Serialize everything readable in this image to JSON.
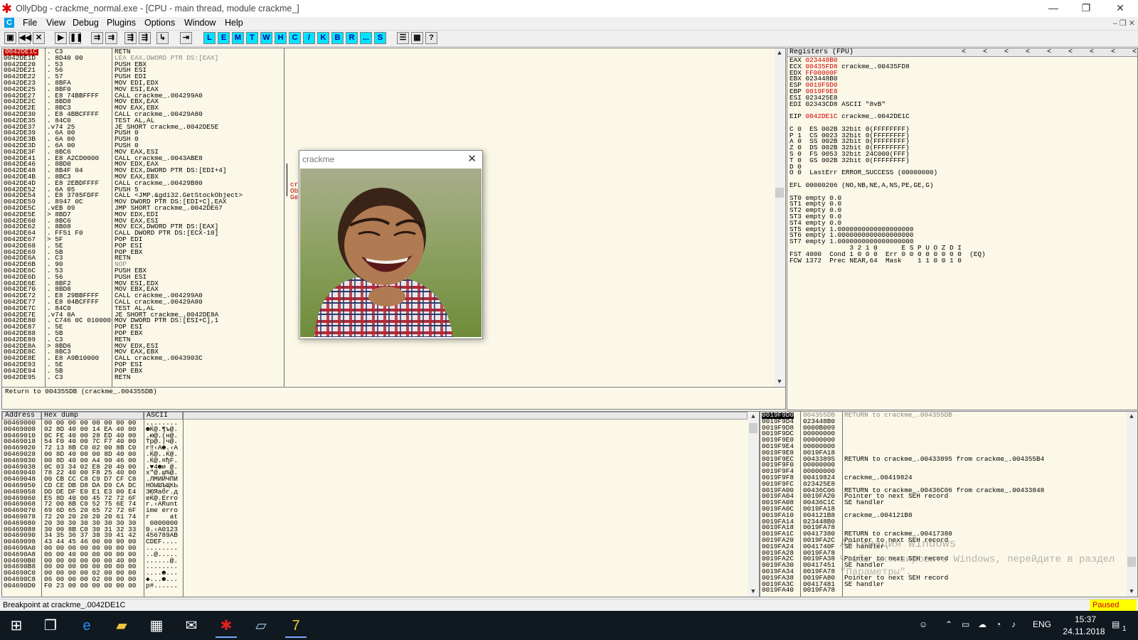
{
  "window": {
    "title": "OllyDbg - crackme_normal.exe - [CPU - main thread, module crackme_]",
    "logo_char": "✱",
    "minimize": "—",
    "restore": "❐",
    "close": "✕"
  },
  "menubar": {
    "icon_char": "C",
    "items": [
      "File",
      "View",
      "Debug",
      "Plugins",
      "Options",
      "Window",
      "Help"
    ],
    "mdi": "–  ❐  ✕"
  },
  "toolbar": {
    "nav_buttons": [
      "▣",
      "◀◀",
      "✕",
      "▶",
      "❚❚",
      "⇉",
      "⇉",
      "⇶",
      "⇶",
      "↳",
      "⇥"
    ],
    "letter_buttons": [
      "L",
      "E",
      "M",
      "T",
      "W",
      "H",
      "C",
      "/",
      "K",
      "B",
      "R",
      "...",
      "S"
    ],
    "extra_buttons": [
      "☰",
      "▦",
      "?"
    ]
  },
  "disasm": {
    "rows": [
      [
        "0042DE1C",
        ". C3",
        "RETN"
      ],
      [
        "0042DE1D",
        ". 8D40 00",
        "LEA EAX,DWORD PTR DS:[EAX]"
      ],
      [
        "0042DE20",
        ". 53",
        "PUSH EBX"
      ],
      [
        "0042DE21",
        ". 56",
        "PUSH ESI"
      ],
      [
        "0042DE22",
        ". 57",
        "PUSH EDI"
      ],
      [
        "0042DE23",
        ". 8BFA",
        "MOV EDI,EDX"
      ],
      [
        "0042DE25",
        ". 8BF0",
        "MOV ESI,EAX"
      ],
      [
        "0042DE27",
        ". E8 74BBFFFF",
        "CALL crackme_.004299A0"
      ],
      [
        "0042DE2C",
        ". 8BD8",
        "MOV EBX,EAX"
      ],
      [
        "0042DE2E",
        ". 8BC3",
        "MOV EAX,EBX"
      ],
      [
        "0042DE30",
        ". E8 4BBCFFFF",
        "CALL crackme_.00429A80"
      ],
      [
        "0042DE35",
        ". 84C0",
        "TEST AL,AL"
      ],
      [
        "0042DE37",
        ".v74 25",
        "JE SHORT crackme_.0042DE5E"
      ],
      [
        "0042DE39",
        ". 6A 00",
        "PUSH 0"
      ],
      [
        "0042DE3B",
        ". 6A 00",
        "PUSH 0"
      ],
      [
        "0042DE3D",
        ". 6A 00",
        "PUSH 0"
      ],
      [
        "0042DE3F",
        ". 8BC6",
        "MOV EAX,ESI"
      ],
      [
        "0042DE41",
        ". E8 A2CD0000",
        "CALL crackme_.0043ABE8"
      ],
      [
        "0042DE46",
        ". 8BD0",
        "MOV EDX,EAX"
      ],
      [
        "0042DE48",
        ". 8B4F 04",
        "MOV ECX,DWORD PTR DS:[EDI+4]"
      ],
      [
        "0042DE4B",
        ". 8BC3",
        "MOV EAX,EBX"
      ],
      [
        "0042DE4D",
        ". E8 2EBDFFFF",
        "CALL crackme_.00429B80"
      ],
      [
        "0042DE52",
        ". 6A 05",
        "PUSH 5"
      ],
      [
        "0042DE54",
        ". E8 3785FDFF",
        "CALL <JMP.&gdi32.GetStockObject>"
      ],
      [
        "0042DE59",
        ". 8947 0C",
        "MOV DWORD PTR DS:[EDI+C],EAX"
      ],
      [
        "0042DE5C",
        ".vEB 09",
        "JMP SHORT crackme_.0042DE67"
      ],
      [
        "0042DE5E",
        "> 8BD7",
        "MOV EDX,EDI"
      ],
      [
        "0042DE60",
        ". 8BC6",
        "MOV EAX,ESI"
      ],
      [
        "0042DE62",
        ". 8B08",
        "MOV ECX,DWORD PTR DS:[EAX]"
      ],
      [
        "0042DE64",
        ". FF51 F0",
        "CALL DWORD PTR DS:[ECX-10]"
      ],
      [
        "0042DE67",
        "> 5F",
        "POP EDI"
      ],
      [
        "0042DE68",
        ". 5E",
        "POP ESI"
      ],
      [
        "0042DE69",
        ". 5B",
        "POP EBX"
      ],
      [
        "0042DE6A",
        ". C3",
        "RETN"
      ],
      [
        "0042DE6B",
        ". 90",
        "NOP"
      ],
      [
        "0042DE6C",
        ". 53",
        "PUSH EBX"
      ],
      [
        "0042DE6D",
        ". 56",
        "PUSH ESI"
      ],
      [
        "0042DE6E",
        ". 8BF2",
        "MOV ESI,EDX"
      ],
      [
        "0042DE70",
        ". 8BD8",
        "MOV EBX,EAX"
      ],
      [
        "0042DE72",
        ". E8 29BBFFFF",
        "CALL crackme_.004299A0"
      ],
      [
        "0042DE77",
        ". E8 04BCFFFF",
        "CALL crackme_.00429A80"
      ],
      [
        "0042DE7C",
        ". 84C0",
        "TEST AL,AL"
      ],
      [
        "0042DE7E",
        ".v74 0A",
        "JE SHORT crackme_.0042DE8A"
      ],
      [
        "0042DE80",
        ". C746 0C 010000",
        "MOV DWORD PTR DS:[ESI+C],1"
      ],
      [
        "0042DE87",
        ". 5E",
        "POP ESI"
      ],
      [
        "0042DE88",
        ". 5B",
        "POP EBX"
      ],
      [
        "0042DE89",
        ". C3",
        "RETN"
      ],
      [
        "0042DE8A",
        "> 8BD6",
        "MOV EDX,ESI"
      ],
      [
        "0042DE8C",
        ". 8BC3",
        "MOV EAX,EBX"
      ],
      [
        "0042DE8E",
        ". E8 A9B10000",
        "CALL crackme_.0043903C"
      ],
      [
        "0042DE93",
        ". 5E",
        "POP ESI"
      ],
      [
        "0042DE94",
        ". 5B",
        "POP EBX"
      ],
      [
        "0042DE95",
        ". C3",
        "RETN"
      ]
    ],
    "comments": [
      "cr",
      "Ob",
      "Ge"
    ]
  },
  "info": {
    "text": "Return to 004355DB (crackme_.004355DB)"
  },
  "registers": {
    "header": "Registers (FPU)",
    "header_arrows": "<    <    <    <    <    <    <    <    <",
    "lines": [
      {
        "text": "EAX 023448B0",
        "red": true
      },
      {
        "text": "ECX 00435FD8 crackme_.00435FD8",
        "red": true
      },
      {
        "text": "EDX FF00000F",
        "red": true
      },
      {
        "text": "EBX 023448B0",
        "red": false
      },
      {
        "text": "ESP 0019F9D0",
        "red": true
      },
      {
        "text": "EBP 0019F9E8",
        "red": true
      },
      {
        "text": "ESI 023425E8",
        "red": false
      },
      {
        "text": "EDI 02343CD8 ASCII \"8vB\"",
        "red": false
      },
      {
        "text": "",
        "red": false
      },
      {
        "text": "EIP 0042DE1C crackme_.0042DE1C",
        "red": true
      },
      {
        "text": "",
        "red": false
      },
      {
        "text": "C 0  ES 002B 32bit 0(FFFFFFFF)",
        "red": false
      },
      {
        "text": "P 1  CS 0023 32bit 0(FFFFFFFF)",
        "red": false
      },
      {
        "text": "A 0  SS 002B 32bit 0(FFFFFFFF)",
        "red": false
      },
      {
        "text": "Z 0  DS 002B 32bit 0(FFFFFFFF)",
        "red": false
      },
      {
        "text": "S 0  FS 0053 32bit 24C000(FFF)",
        "red": false
      },
      {
        "text": "T 0  GS 002B 32bit 0(FFFFFFFF)",
        "red": false
      },
      {
        "text": "D 0",
        "red": false
      },
      {
        "text": "O 0  LastErr ERROR_SUCCESS (00000000)",
        "red": false
      },
      {
        "text": "",
        "red": false
      },
      {
        "text": "EFL 00000206 (NO,NB,NE,A,NS,PE,GE,G)",
        "red": false
      },
      {
        "text": "",
        "red": false
      },
      {
        "text": "ST0 empty 0.0",
        "red": false
      },
      {
        "text": "ST1 empty 0.0",
        "red": false
      },
      {
        "text": "ST2 empty 0.0",
        "red": false
      },
      {
        "text": "ST3 empty 0.0",
        "red": false
      },
      {
        "text": "ST4 empty 0.0",
        "red": false
      },
      {
        "text": "ST5 empty 1.0000000000000000000",
        "red": false
      },
      {
        "text": "ST6 empty 1.0000000000000000000",
        "red": false
      },
      {
        "text": "ST7 empty 1.0000000000000000000",
        "red": false
      },
      {
        "text": "               3 2 1 0      E S P U O Z D I",
        "red": false
      },
      {
        "text": "FST 4000  Cond 1 0 0 0  Err 0 0 0 0 0 0 0 0  (EQ)",
        "red": false
      },
      {
        "text": "FCW 1372  Prec NEAR,64  Mask    1 1 0 0 1 0",
        "red": false
      }
    ]
  },
  "hexdump": {
    "headers": [
      "Address",
      "Hex dump",
      "ASCII"
    ],
    "rows": [
      [
        "00469000",
        "00 00 00 00 00 00 00 00",
        "........"
      ],
      [
        "00469008",
        "02 8D 40 00 14 EA 40 00",
        "☻Ќ@.¶ъ@."
      ],
      [
        "00469010",
        "0C FE 40 00 28 ED 40 00",
        ".ю@.(н@."
      ],
      [
        "00469018",
        "54 F0 40 00 7C F7 40 00",
        "Tр@.|ч@."
      ],
      [
        "00469020",
        "72 13 8B C0 02 00 8B C0",
        "r‼‹А☻.‹А"
      ],
      [
        "00469028",
        "00 8D 40 00 00 8D 40 00",
        ".Ќ@..Ќ@."
      ],
      [
        "00469030",
        "00 8D 40 00 A4 90 46 00",
        ".Ќ@.¤ђF."
      ],
      [
        "00469038",
        "0C 03 34 02 E8 20 40 00",
        ".♥4☻и @."
      ],
      [
        "00469040",
        "78 22 40 00 F8 25 40 00",
        "x\"@.ш%@."
      ],
      [
        "00469048",
        "00 CB CC C8 C9 D7 CF C8",
        ".ЛМИЙЧПИ"
      ],
      [
        "00469050",
        "CD CE DB D8 DA D9 CA DC",
        "НОЫШЪЩКЬ"
      ],
      [
        "00469058",
        "DD DE DF E0 E1 E3 00 E4",
        "ЭЮЯабг.д"
      ],
      [
        "00469060",
        "E5 8D 40 00 45 72 72 6F",
        "еЌ@.Erro"
      ],
      [
        "00469068",
        "72 00 8B C0 52 75 6E 74",
        "r.‹АRunt"
      ],
      [
        "00469070",
        "69 6D 65 20 65 72 72 6F",
        "ime erro"
      ],
      [
        "00469078",
        "72 20 20 20 20 20 61 74",
        "r     at"
      ],
      [
        "00469080",
        "20 30 30 30 30 30 30 30",
        " 0000000"
      ],
      [
        "00469088",
        "30 00 8B C0 30 31 32 33",
        "0.‹А0123"
      ],
      [
        "00469090",
        "34 35 36 37 38 39 41 42",
        "456789AB"
      ],
      [
        "00469098",
        "43 44 45 46 00 00 00 00",
        "CDEF...."
      ],
      [
        "004690A0",
        "00 00 00 00 00 00 00 00",
        "........"
      ],
      [
        "004690A8",
        "00 00 40 00 00 00 00 00",
        "..@....."
      ],
      [
        "004690B0",
        "00 00 00 00 00 00 40 00",
        "......@."
      ],
      [
        "004690B8",
        "00 00 00 00 00 00 00 00",
        "........"
      ],
      [
        "004690C0",
        "00 00 00 00 02 00 00 00",
        "....☻..."
      ],
      [
        "004690C8",
        "06 00 00 00 02 00 00 00",
        "♠...☻..."
      ],
      [
        "004690D0",
        "F0 23 00 00 00 00 00 00",
        "р#......"
      ]
    ]
  },
  "stack": {
    "rows": [
      [
        "0019F9D0",
        "004355DB",
        "RETURN to crackme_.004355DB",
        true
      ],
      [
        "0019F9D4",
        "023448B0",
        "",
        false
      ],
      [
        "0019F9D8",
        "0000B009",
        "",
        false
      ],
      [
        "0019F9DC",
        "00000000",
        "",
        false
      ],
      [
        "0019F9E0",
        "00000000",
        "",
        false
      ],
      [
        "0019F9E4",
        "00000000",
        "",
        false
      ],
      [
        "0019F9E8",
        "0019FA18",
        "",
        false
      ],
      [
        "0019F9EC",
        "00433895",
        "RETURN to crackme_.00433895 from crackme_.004355B4",
        false
      ],
      [
        "0019F9F0",
        "00000000",
        "",
        false
      ],
      [
        "0019F9F4",
        "00000000",
        "",
        false
      ],
      [
        "0019F9F8",
        "00419824",
        "crackme_.00419824",
        false
      ],
      [
        "0019F9FC",
        "023425E8",
        "",
        false
      ],
      [
        "0019FA00",
        "00436C06",
        "RETURN to crackme_.00436C06 from crackme_.00433848",
        false
      ],
      [
        "0019FA04",
        "0019FA20",
        "Pointer to next SEH record",
        false
      ],
      [
        "0019FA08",
        "00436C1C",
        "SE handler",
        false
      ],
      [
        "0019FA0C",
        "0019FA18",
        "",
        false
      ],
      [
        "0019FA10",
        "004121B8",
        "crackme_.004121B8",
        false
      ],
      [
        "0019FA14",
        "023448B0",
        "",
        false
      ],
      [
        "0019FA18",
        "0019FA78",
        "",
        false
      ],
      [
        "0019FA1C",
        "00417380",
        "RETURN to crackme_.00417380",
        false
      ],
      [
        "0019FA20",
        "0019FA2C",
        "Pointer to next SEH record",
        false
      ],
      [
        "0019FA24",
        "0041740F",
        "SE handler",
        false
      ],
      [
        "0019FA28",
        "0019FA78",
        "",
        false
      ],
      [
        "0019FA2C",
        "0019FA38",
        "Pointer to next SEH record",
        false
      ],
      [
        "0019FA30",
        "00417451",
        "SE handler",
        false
      ],
      [
        "0019FA34",
        "0019FA78",
        "",
        false
      ],
      [
        "0019FA38",
        "0019FA80",
        "Pointer to next SEH record",
        false
      ],
      [
        "0019FA3C",
        "00417481",
        "SE handler",
        false
      ],
      [
        "0019FA40",
        "0019FA78",
        "",
        false
      ]
    ],
    "watermark_line1": "Активация Windows",
    "watermark_line2": "Чтобы активировать Windows, перейдите в раздел",
    "watermark_line3": "\"Параметры\"."
  },
  "status": {
    "message": "Breakpoint at crackme_.0042DE1C",
    "state": "Paused"
  },
  "dialog": {
    "title": "crackme",
    "close": "✕"
  },
  "taskbar": {
    "time": "15:37",
    "date": "24.11.2018",
    "lang": "ENG",
    "notify_count": "1"
  }
}
